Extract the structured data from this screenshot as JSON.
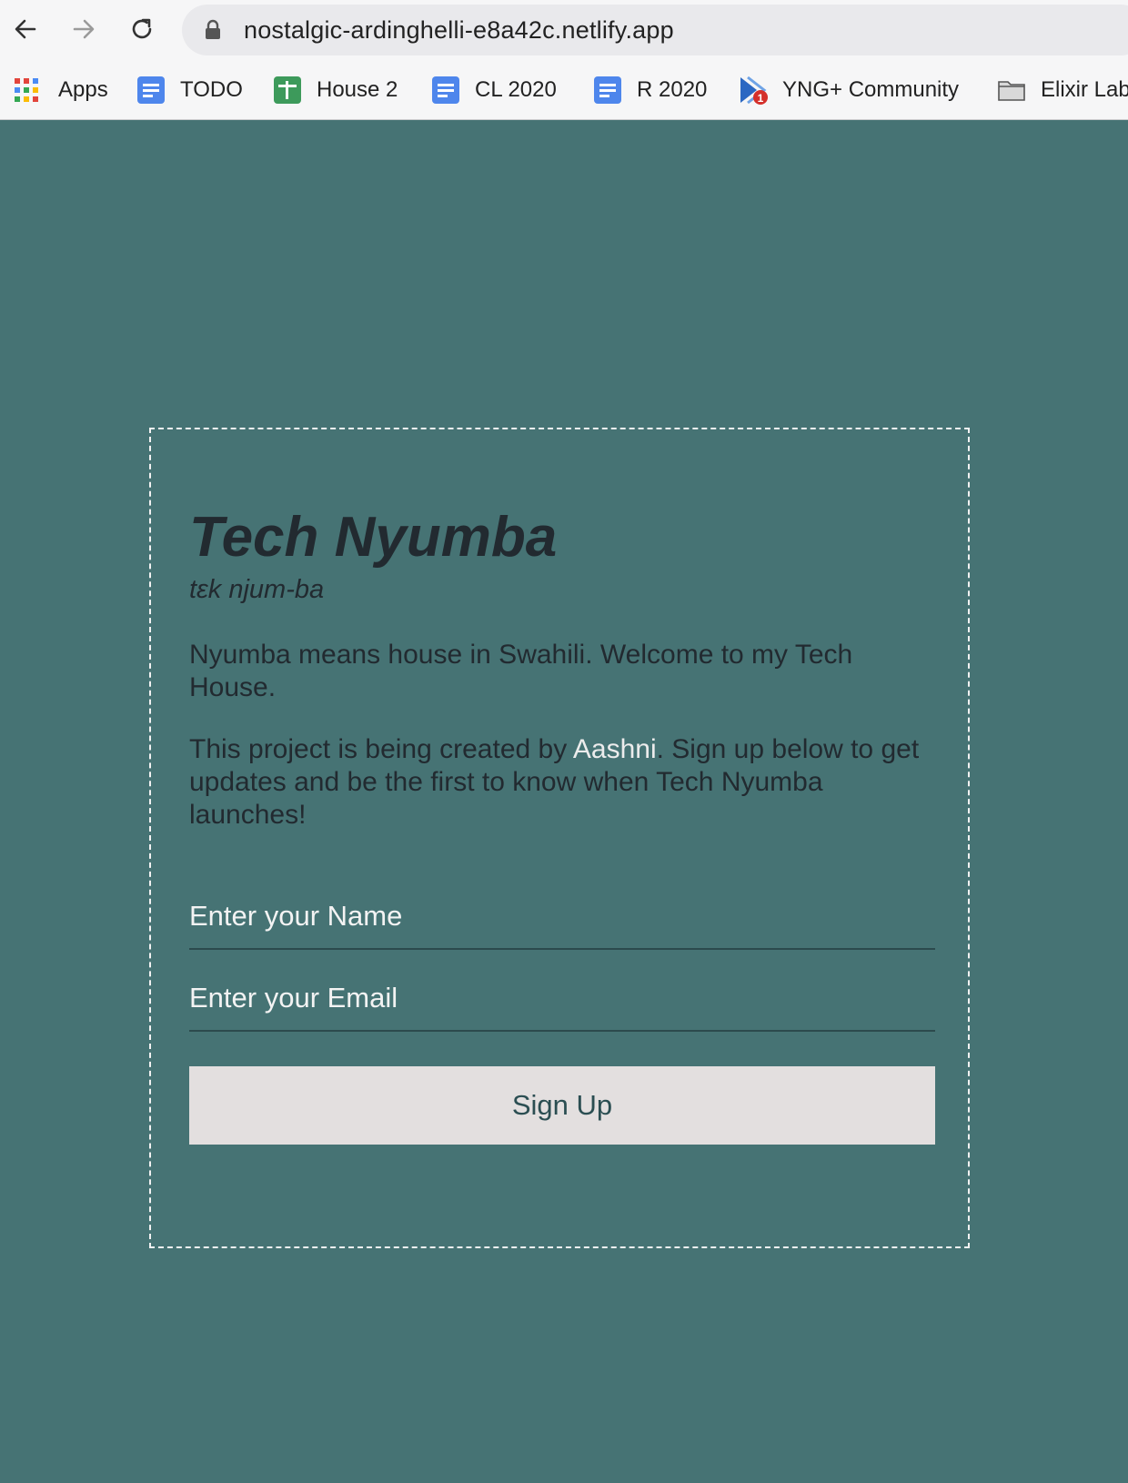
{
  "browser": {
    "url": "nostalgic-ardinghelli-e8a42c.netlify.app",
    "bookmarks": [
      {
        "label": "Apps",
        "icon": "apps-grid-icon"
      },
      {
        "label": "TODO",
        "icon": "google-docs-icon"
      },
      {
        "label": "House 2",
        "icon": "google-sheets-icon"
      },
      {
        "label": "CL 2020",
        "icon": "google-docs-icon"
      },
      {
        "label": "R 2020",
        "icon": "google-docs-icon"
      },
      {
        "label": "YNG+ Community",
        "icon": "yng-community-icon"
      },
      {
        "label": "Elixir Lab",
        "icon": "folder-icon"
      }
    ]
  },
  "page": {
    "title": "Tech Nyumba",
    "pronunciation": "tɛk njum-ba",
    "intro": "Nyumba means house in Swahili. Welcome to my Tech House.",
    "project_before": "This project is being created by ",
    "project_author": "Aashni",
    "project_after": ". Sign up below to get updates and be the first to know when Tech Nyumba launches!"
  },
  "form": {
    "name_placeholder": "Enter your Name",
    "email_placeholder": "Enter your Email",
    "submit_label": "Sign Up"
  },
  "colors": {
    "background": "#467374",
    "text": "#222a30",
    "button_bg": "#e3dfdf",
    "button_text": "#2b4e52"
  }
}
